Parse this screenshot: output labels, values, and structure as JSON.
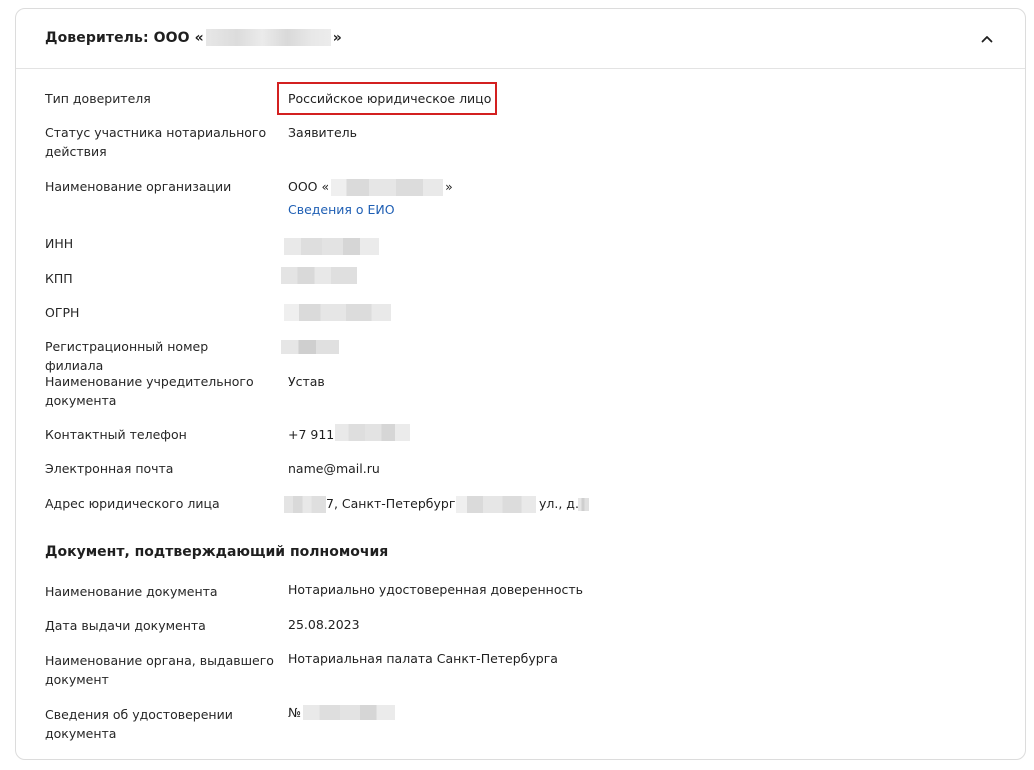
{
  "header": {
    "title_prefix": "Доверитель: ООО «",
    "title_suffix": "»"
  },
  "principal": {
    "type_label": "Тип доверителя",
    "type_value": "Российское юридическое лицо",
    "status_label": "Статус участника нотариального действия",
    "status_value": "Заявитель",
    "org_name_label": "Наименование организации",
    "org_name_prefix": "ООО «",
    "org_name_suffix": "»",
    "eio_link": "Сведения о ЕИО",
    "inn_label": "ИНН",
    "kpp_label": "КПП",
    "ogrn_label": "ОГРН",
    "branch_reg_label": "Регистрационный номер филиала",
    "founding_doc_label": "Наименование учредительного документа",
    "founding_doc_value": "Устав",
    "phone_label": "Контактный телефон",
    "phone_prefix": "+7 911",
    "email_label": "Электронная почта",
    "email_value": "name@mail.ru",
    "address_label": "Адрес юридического лица",
    "address_part1": "7, Санкт-Петербург,",
    "address_part2": "ул., д."
  },
  "authority_doc": {
    "section_title": "Документ, подтверждающий полномочия",
    "doc_name_label": "Наименование документа",
    "doc_name_value": "Нотариально удостоверенная доверенность",
    "issue_date_label": "Дата выдачи документа",
    "issue_date_value": "25.08.2023",
    "issuer_label": "Наименование органа, выдавшего документ",
    "issuer_value": "Нотариальная палата Санкт-Петербурга",
    "cert_label": "Сведения об удостоверении документа",
    "cert_prefix": "№"
  },
  "icons": {
    "collapse": "chevron-up-icon"
  },
  "colors": {
    "highlight_border": "#d32020",
    "link": "#1f5fb4"
  }
}
